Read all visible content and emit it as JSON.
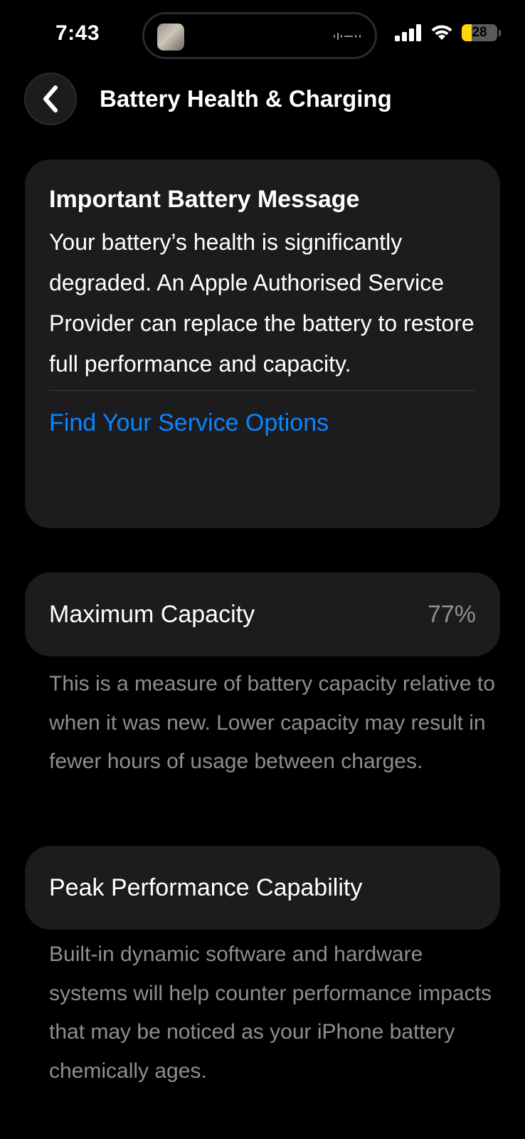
{
  "status_bar": {
    "time": "7:43",
    "battery_percent": "28",
    "battery_level": 0.28,
    "icons": [
      "cellular-signal-icon",
      "wifi-icon",
      "battery-icon"
    ]
  },
  "header": {
    "title": "Battery Health & Charging",
    "back_icon": "chevron-left-icon"
  },
  "message_card": {
    "title": "Important Battery Message",
    "body": "Your battery’s health is significantly degraded. An Apple Authorised Service Provider can replace the battery to restore full performance and capacity.",
    "link": "Find Your Service Options"
  },
  "maximum_capacity": {
    "label": "Maximum Capacity",
    "value": "77%",
    "footnote": "This is a measure of battery capacity relative to when it was new. Lower capacity may result in fewer hours of usage between charges."
  },
  "peak_performance": {
    "label": "Peak Performance Capability",
    "footnote": "Built-in dynamic software and hardware systems will help counter performance impacts that may be noticed as your iPhone battery chemically ages."
  },
  "colors": {
    "background": "#000000",
    "card": "#1c1c1e",
    "link": "#0a84ff",
    "secondary_text": "#8e8e93",
    "battery_low": "#ffd60a"
  }
}
